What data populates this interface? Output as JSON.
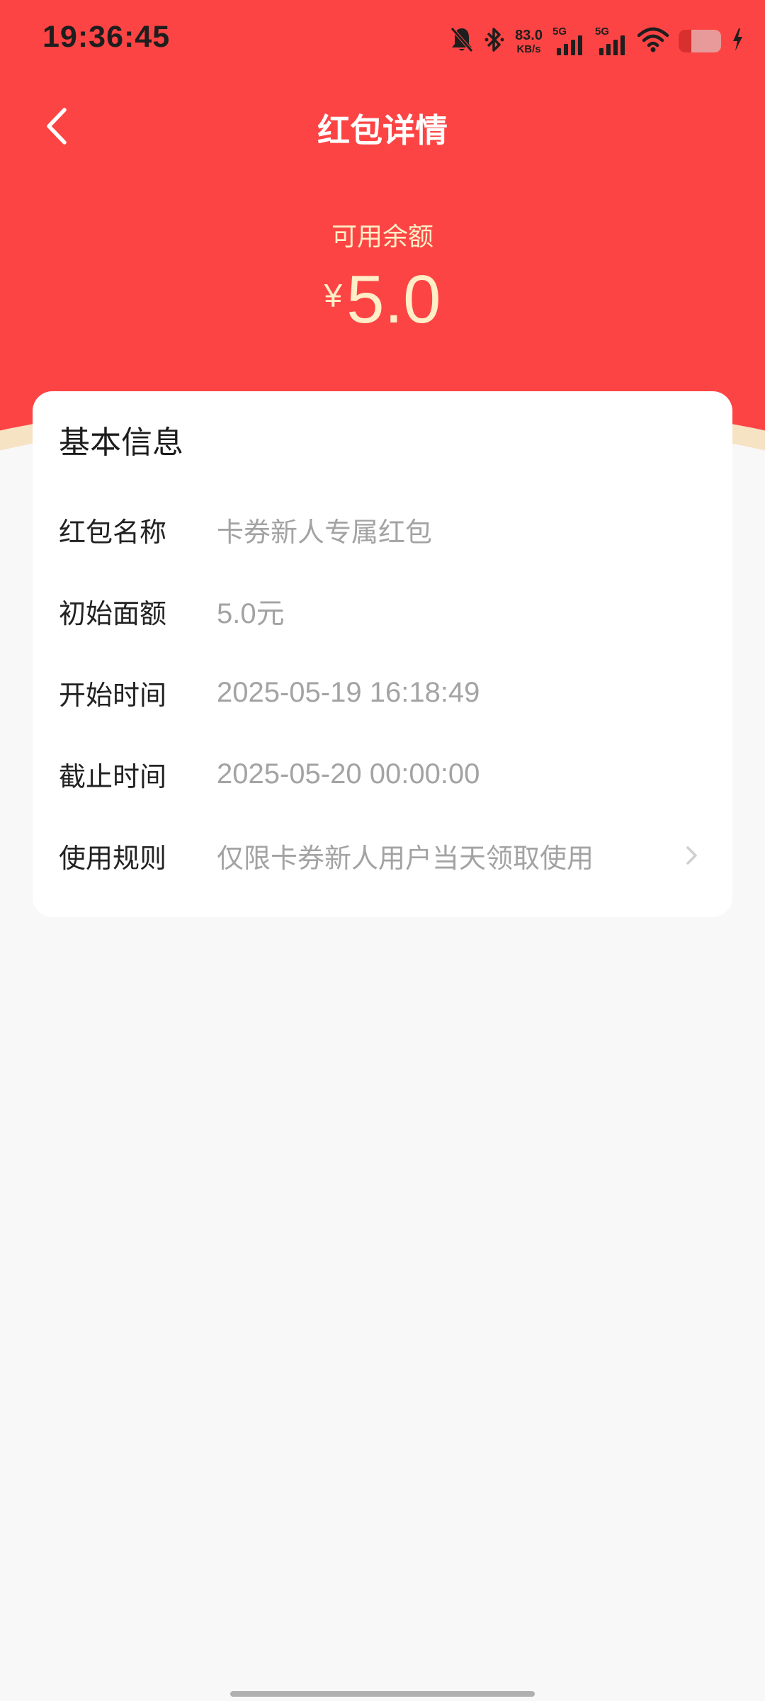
{
  "status_bar": {
    "time": "19:36:45",
    "net_speed_value": "83.0",
    "net_speed_unit": "KB/s",
    "sim1_label": "5G",
    "sim2_label": "5G",
    "battery_level": 0.3
  },
  "nav": {
    "title": "红包详情"
  },
  "balance": {
    "label": "可用余额",
    "currency": "¥",
    "amount": "5.0"
  },
  "basic_info": {
    "title": "基本信息",
    "rows": [
      {
        "label": "红包名称",
        "value": "卡券新人专属红包"
      },
      {
        "label": "初始面额",
        "value": "5.0元"
      },
      {
        "label": "开始时间",
        "value": "2025-05-19 16:18:49"
      },
      {
        "label": "截止时间",
        "value": "2025-05-20 00:00:00"
      },
      {
        "label": "使用规则",
        "value": "仅限卡券新人用户当天领取使用"
      }
    ]
  },
  "colors": {
    "header_red": "#fd4444",
    "gold_text": "#ffeec7",
    "cream_band": "#f5e3c4",
    "value_gray": "#a3a3a3"
  },
  "icons": [
    "back-arrow-icon",
    "bell-muted-icon",
    "bluetooth-icon",
    "signal-icon",
    "wifi-icon",
    "battery-icon",
    "charging-icon",
    "chevron-right-icon"
  ]
}
